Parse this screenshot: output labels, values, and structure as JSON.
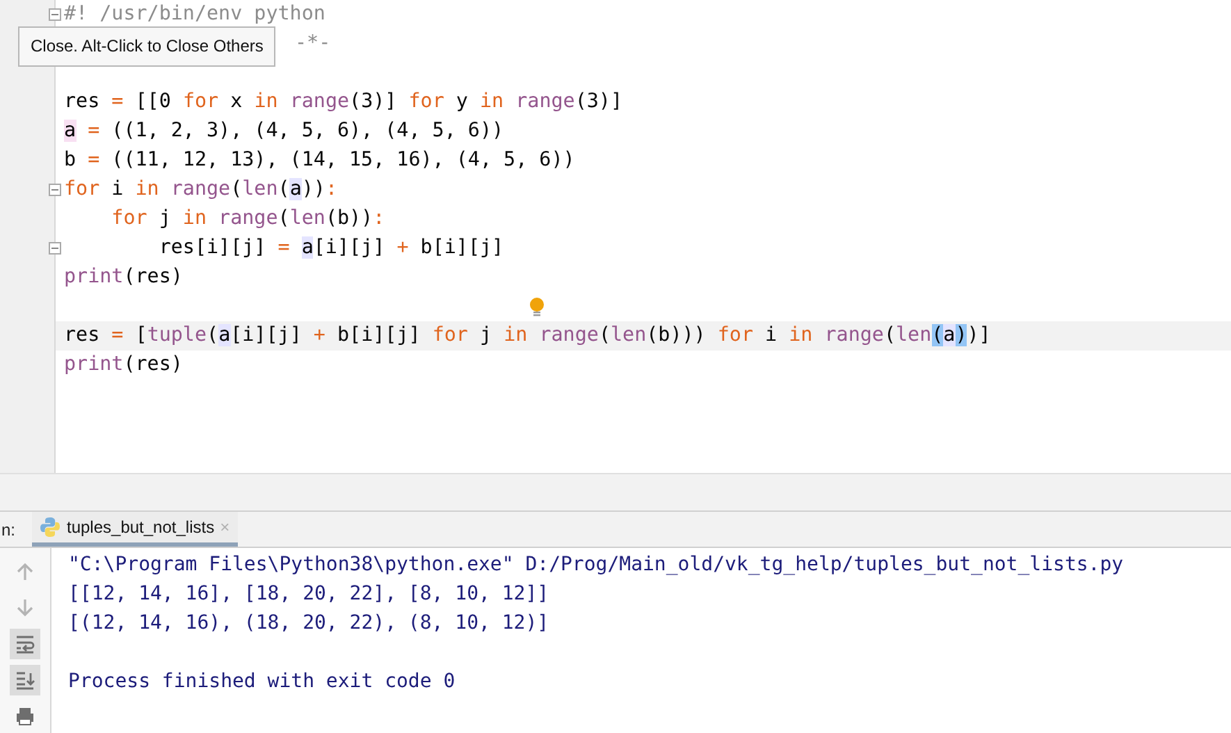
{
  "editor": {
    "lines": [
      {
        "fold_marker": true,
        "covered": false,
        "current": false,
        "intention": false,
        "tokens": [
          {
            "text": "#! /usr/bin/env python",
            "kind": "c"
          }
        ]
      },
      {
        "fold_marker": false,
        "covered": true,
        "current": false,
        "intention": false,
        "tokens": [
          {
            "text": "-*-",
            "kind": "c"
          }
        ]
      },
      {
        "fold_marker": false,
        "current": false,
        "intention": false
      },
      {
        "fold_marker": false,
        "covered": false,
        "current": false,
        "intention": false,
        "tokens": [
          {
            "text": "res ",
            "kind": "t"
          },
          {
            "text": "=",
            "kind": "k"
          },
          {
            "text": " [[0 ",
            "kind": "t"
          },
          {
            "text": "for",
            "kind": "k"
          },
          {
            "text": " x ",
            "kind": "t"
          },
          {
            "text": "in",
            "kind": "k"
          },
          {
            "text": " range",
            "kind": "f"
          },
          {
            "text": "(3)] ",
            "kind": "t"
          },
          {
            "text": "for",
            "kind": "k"
          },
          {
            "text": " y ",
            "kind": "t"
          },
          {
            "text": "in",
            "kind": "k"
          },
          {
            "text": " range",
            "kind": "f"
          },
          {
            "text": "(3)]",
            "kind": "t"
          }
        ]
      },
      {
        "fold_marker": false,
        "covered": false,
        "current": false,
        "intention": false,
        "tokens": [
          {
            "text": "a",
            "kind": "w"
          },
          {
            "text": " =",
            "kind": "k"
          },
          {
            "text": " ((1, 2, 3), (4, 5, 6), (4, 5, 6))",
            "kind": "t"
          }
        ]
      },
      {
        "fold_marker": false,
        "covered": false,
        "current": false,
        "intention": false,
        "tokens": [
          {
            "text": "b ",
            "kind": "t"
          },
          {
            "text": "=",
            "kind": "k"
          },
          {
            "text": " ((11, 12, 13), (14, 15, 16), (4, 5, 6))",
            "kind": "t"
          }
        ]
      },
      {
        "fold_marker": true,
        "covered": false,
        "current": false,
        "intention": false,
        "tokens": [
          {
            "text": "for",
            "kind": "k"
          },
          {
            "text": " i ",
            "kind": "t"
          },
          {
            "text": "in",
            "kind": "k"
          },
          {
            "text": " range",
            "kind": "f"
          },
          {
            "text": "(",
            "kind": "t"
          },
          {
            "text": "len",
            "kind": "f"
          },
          {
            "text": "(",
            "kind": "t"
          },
          {
            "text": "a",
            "kind": "u"
          },
          {
            "text": "))",
            "kind": "t"
          },
          {
            "text": ":",
            "kind": "k"
          }
        ]
      },
      {
        "fold_marker": false,
        "covered": false,
        "current": false,
        "intention": false,
        "tokens": [
          {
            "text": "    for",
            "kind": "k"
          },
          {
            "text": " j ",
            "kind": "t"
          },
          {
            "text": "in",
            "kind": "k"
          },
          {
            "text": " range",
            "kind": "f"
          },
          {
            "text": "(",
            "kind": "t"
          },
          {
            "text": "len",
            "kind": "f"
          },
          {
            "text": "(b))",
            "kind": "t"
          },
          {
            "text": ":",
            "kind": "k"
          }
        ]
      },
      {
        "fold_marker": true,
        "covered": false,
        "current": false,
        "intention": false,
        "tokens": [
          {
            "text": "        res[i][j] ",
            "kind": "t"
          },
          {
            "text": "= ",
            "kind": "k"
          },
          {
            "text": "a",
            "kind": "u"
          },
          {
            "text": "[i][j] ",
            "kind": "t"
          },
          {
            "text": "+",
            "kind": "k"
          },
          {
            "text": " b[i][j]",
            "kind": "t"
          }
        ]
      },
      {
        "fold_marker": false,
        "covered": false,
        "current": false,
        "intention": false,
        "tokens": [
          {
            "text": "print",
            "kind": "f"
          },
          {
            "text": "(res)",
            "kind": "t"
          }
        ]
      },
      {
        "fold_marker": false,
        "current": false,
        "intention": true
      },
      {
        "fold_marker": false,
        "covered": false,
        "current": true,
        "intention": false,
        "tokens": [
          {
            "text": "res ",
            "kind": "t"
          },
          {
            "text": "=",
            "kind": "k"
          },
          {
            "text": " [",
            "kind": "t"
          },
          {
            "text": "tuple",
            "kind": "f"
          },
          {
            "text": "(",
            "kind": "t"
          },
          {
            "text": "a",
            "kind": "u"
          },
          {
            "text": "[i][j] ",
            "kind": "t"
          },
          {
            "text": "+",
            "kind": "k"
          },
          {
            "text": " b[i][j] ",
            "kind": "t"
          },
          {
            "text": "for",
            "kind": "k"
          },
          {
            "text": " j ",
            "kind": "t"
          },
          {
            "text": "in",
            "kind": "k"
          },
          {
            "text": " range",
            "kind": "f"
          },
          {
            "text": "(",
            "kind": "t"
          },
          {
            "text": "len",
            "kind": "f"
          },
          {
            "text": "(b))) ",
            "kind": "t"
          },
          {
            "text": "for",
            "kind": "k"
          },
          {
            "text": " i ",
            "kind": "t"
          },
          {
            "text": "in",
            "kind": "k"
          },
          {
            "text": " range",
            "kind": "f"
          },
          {
            "text": "(",
            "kind": "t"
          },
          {
            "text": "len",
            "kind": "f"
          },
          {
            "text": "(",
            "kind": "b"
          },
          {
            "text": "a",
            "kind": "u"
          },
          {
            "text": ")",
            "kind": "b"
          },
          {
            "text": ")]",
            "kind": "t"
          }
        ]
      },
      {
        "fold_marker": false,
        "covered": false,
        "current": false,
        "intention": false,
        "tokens": [
          {
            "text": "print",
            "kind": "f"
          },
          {
            "text": "(res)",
            "kind": "t"
          }
        ]
      }
    ]
  },
  "tooltip": {
    "text": "Close. Alt-Click to Close Others"
  },
  "run_panel": {
    "label": "n:",
    "tabs": [
      {
        "label": "tuples_but_not_lists",
        "close": "×",
        "selected": true
      }
    ]
  },
  "console": {
    "toolbar": [
      {
        "kind": "up",
        "selected": false
      },
      {
        "kind": "down",
        "selected": false
      },
      {
        "kind": "wrap",
        "selected": true
      },
      {
        "kind": "scroll-end",
        "selected": true
      },
      {
        "kind": "print",
        "selected": false
      }
    ],
    "lines": [
      {
        "kind": "out",
        "text": "\"C:\\Program Files\\Python38\\python.exe\" D:/Prog/Main_old/vk_tg_help/tuples_but_not_lists.py"
      },
      {
        "kind": "out",
        "text": "[[12, 14, 16], [18, 20, 22], [8, 10, 12]]"
      },
      {
        "kind": "out",
        "text": "[(12, 14, 16), (18, 20, 22), (8, 10, 12)]"
      },
      {
        "kind": "exit",
        "text": "Process finished with exit code 0"
      }
    ]
  }
}
